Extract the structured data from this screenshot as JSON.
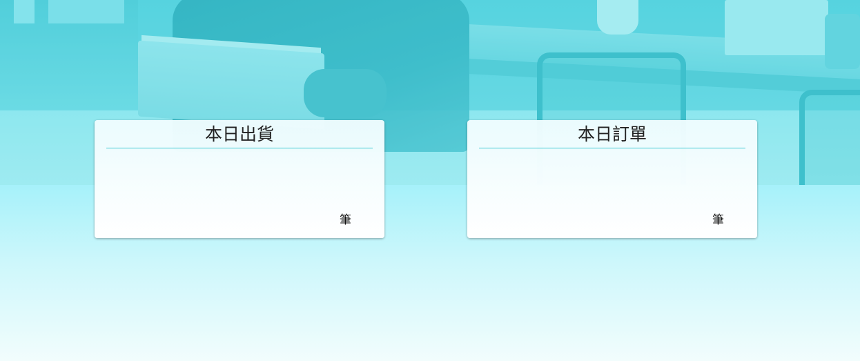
{
  "cards": [
    {
      "title": "本日出貨",
      "count": "",
      "unit": "筆"
    },
    {
      "title": "本日訂單",
      "count": "",
      "unit": "筆"
    }
  ],
  "colors": {
    "accent": "#3cc9d3",
    "background_top": "#a6f1fa",
    "background_bottom": "#f2fdfd"
  }
}
